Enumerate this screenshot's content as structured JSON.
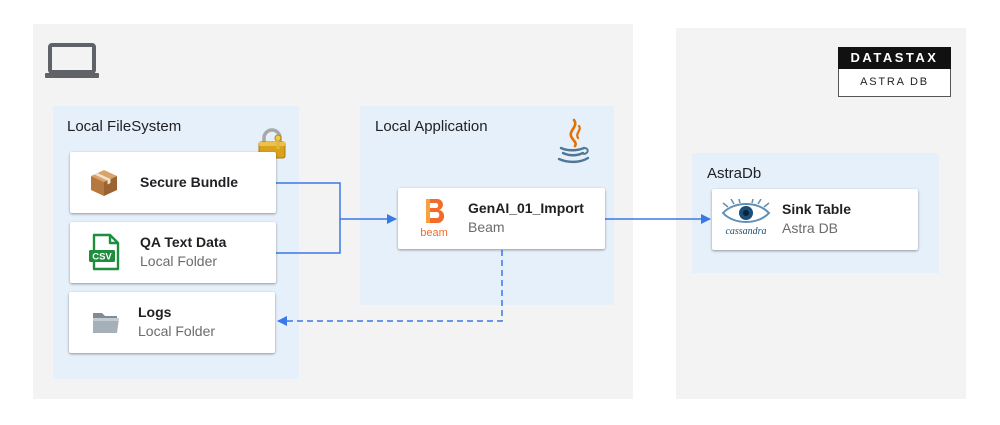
{
  "colors": {
    "panel_grey": "#f3f3f3",
    "panel_blue": "#e6f0fa",
    "connector": "#3b78e7",
    "beam_orange": "#f26b2b"
  },
  "zones": {
    "local": {
      "icon": "laptop-icon"
    },
    "cloud": {
      "logo": {
        "name": "DATASTAX",
        "product": "ASTRA DB"
      }
    }
  },
  "groups": {
    "filesystem": {
      "label": "Local FileSystem",
      "icon": "padlock-icon",
      "nodes": {
        "bundle": {
          "title": "Secure Bundle",
          "icon": "package-box-icon"
        },
        "qa": {
          "title": "QA Text Data",
          "subtitle": "Local Folder",
          "icon": "csv-file-icon",
          "icon_text": "CSV"
        },
        "logs": {
          "title": "Logs",
          "subtitle": "Local Folder",
          "icon": "folder-icon"
        }
      }
    },
    "application": {
      "label": "Local Application",
      "icon": "java-icon",
      "nodes": {
        "import": {
          "title": "GenAI_01_Import",
          "subtitle": "Beam",
          "icon": "beam-icon",
          "icon_text": "beam"
        }
      }
    },
    "astradb": {
      "label": "AstraDb",
      "nodes": {
        "sink": {
          "title": "Sink Table",
          "subtitle": "Astra DB",
          "icon": "cassandra-eye-icon",
          "icon_text": "cassandra"
        }
      }
    }
  }
}
